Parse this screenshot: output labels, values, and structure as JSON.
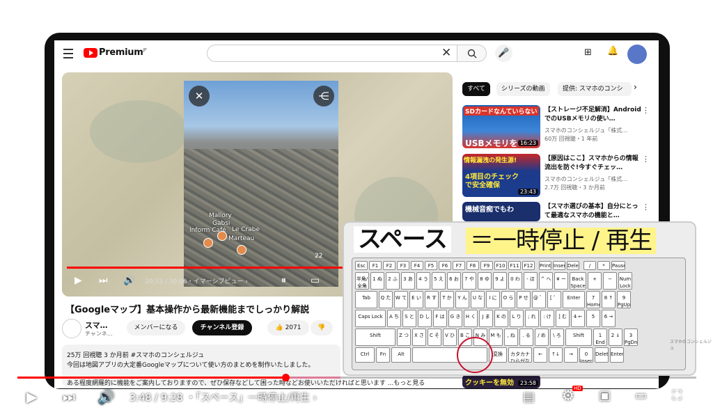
{
  "header": {
    "brand": "Premium",
    "brand_sup": "JP",
    "search_value": ""
  },
  "main_video": {
    "map_labels": [
      "Mallory",
      "Gabsi",
      "Inform Café",
      "Le Crabe",
      "Marteau"
    ],
    "badge": "22",
    "time": "20:33 / 30:06",
    "chapter": "・イマーシブビュー ›",
    "title": "【Googleマップ】基本操作から最新機能までしっかり解説",
    "channel_name": "スマ…",
    "channel_sub": "チャンネ…",
    "member_btn": "メンバーになる",
    "subscribe_btn": "チャンネル登録",
    "likes": "2071",
    "desc_line1": "25万 回視聴  3 か月前  #スマホのコンシェルジュ",
    "desc_line2": "今回は地図アプリの大定番Googleマップについて使い方のまとめを制作いたしました。",
    "desc_line3": "ある程度網羅的に機能をご案内しておりますので、ぜひ保存などして困った時などお使いいただければと思います ...もっと見る"
  },
  "chips": [
    "すべて",
    "シリーズの動画",
    "提供: スマホのコンシ"
  ],
  "related": [
    {
      "thumb_text": "SDカードなんていらない",
      "thumb_sub": "USBメモリを",
      "duration": "16:23",
      "title": "【ストレージ不足解消】AndroidでのUSBメモリの使い…",
      "channel": "スマホのコンシェルジュ「株式…",
      "meta": "60万 回視聴・1 年前"
    },
    {
      "thumb_text": "情報漏洩の発生源!",
      "thumb_sub": "4項目のチェックで安全確保",
      "duration": "23:43",
      "title": "【原因はここ】スマホからの情報流出を防ぐ!今すぐチェッ…",
      "channel": "スマホのコンシェルジュ「株式…",
      "meta": "2.7万 回視聴・3 か月前"
    },
    {
      "thumb_text": "機械音痴でもわ",
      "thumb_sub": "",
      "duration": "",
      "title": "【スマホ選びの基本】自分にとって最適なスマホの機能と…",
      "channel": "スマホのコンシェルジュ「株式…",
      "meta": ""
    }
  ],
  "last_thumb": {
    "text": "クッキーを無効",
    "duration": "23:58"
  },
  "overlay": {
    "caption_left": "スペース",
    "caption_right": "＝一時停止 / 再生"
  },
  "keyboard": {
    "row0": [
      "Esc",
      "F1",
      "F2",
      "F3",
      "F4",
      "F5",
      "F6",
      "F7",
      "F8",
      "F9",
      "F10",
      "F11",
      "F12",
      "Print Screen",
      "Insert",
      "Delete",
      "/",
      "*",
      "Pause Break"
    ],
    "row1": [
      "半角/全角",
      "1 ぬ",
      "2 ふ",
      "3 あ",
      "4 う",
      "5 え",
      "6 お",
      "7 や",
      "8 ゆ",
      "9 よ",
      "0 わ",
      "- ほ",
      "^ へ",
      "¥ ー",
      "Back Space",
      "+",
      "−",
      "Num Lock"
    ],
    "row2": [
      "Tab",
      "Q た",
      "W て",
      "E い",
      "R す",
      "T か",
      "Y ん",
      "U な",
      "I に",
      "O ら",
      "P せ",
      "@ ゛",
      "[ ゜",
      "Enter",
      "7 Home",
      "8 ↑",
      "9 PgUp"
    ],
    "row3": [
      "Caps Lock",
      "A ち",
      "S と",
      "D し",
      "F は",
      "G き",
      "H く",
      "J ま",
      "K の",
      "L り",
      "; れ",
      ": け",
      "] む",
      "4 ←",
      "5",
      "6 →"
    ],
    "row4": [
      "Shift",
      "Z つ",
      "X さ",
      "C そ",
      "V ひ",
      "B こ",
      "N み",
      "M も",
      ", ね",
      ". る",
      "/ め",
      "\\ ろ",
      "Shift",
      "1 End",
      "2 ↓",
      "3 PgDn"
    ],
    "row5": [
      "Ctrl",
      "Fn",
      "Alt",
      "",
      "変換",
      "カタカナ ひらがな ローマ字",
      "←",
      "↑↓",
      "→",
      "0 Insert",
      "Delete",
      "Enter"
    ]
  },
  "player": {
    "time": "3:48 / 9:28",
    "chapter": "・「スペース」一時停止/再生 ›",
    "hd_badge": "HD"
  },
  "watermark": "スマホのコンシェルジュ"
}
